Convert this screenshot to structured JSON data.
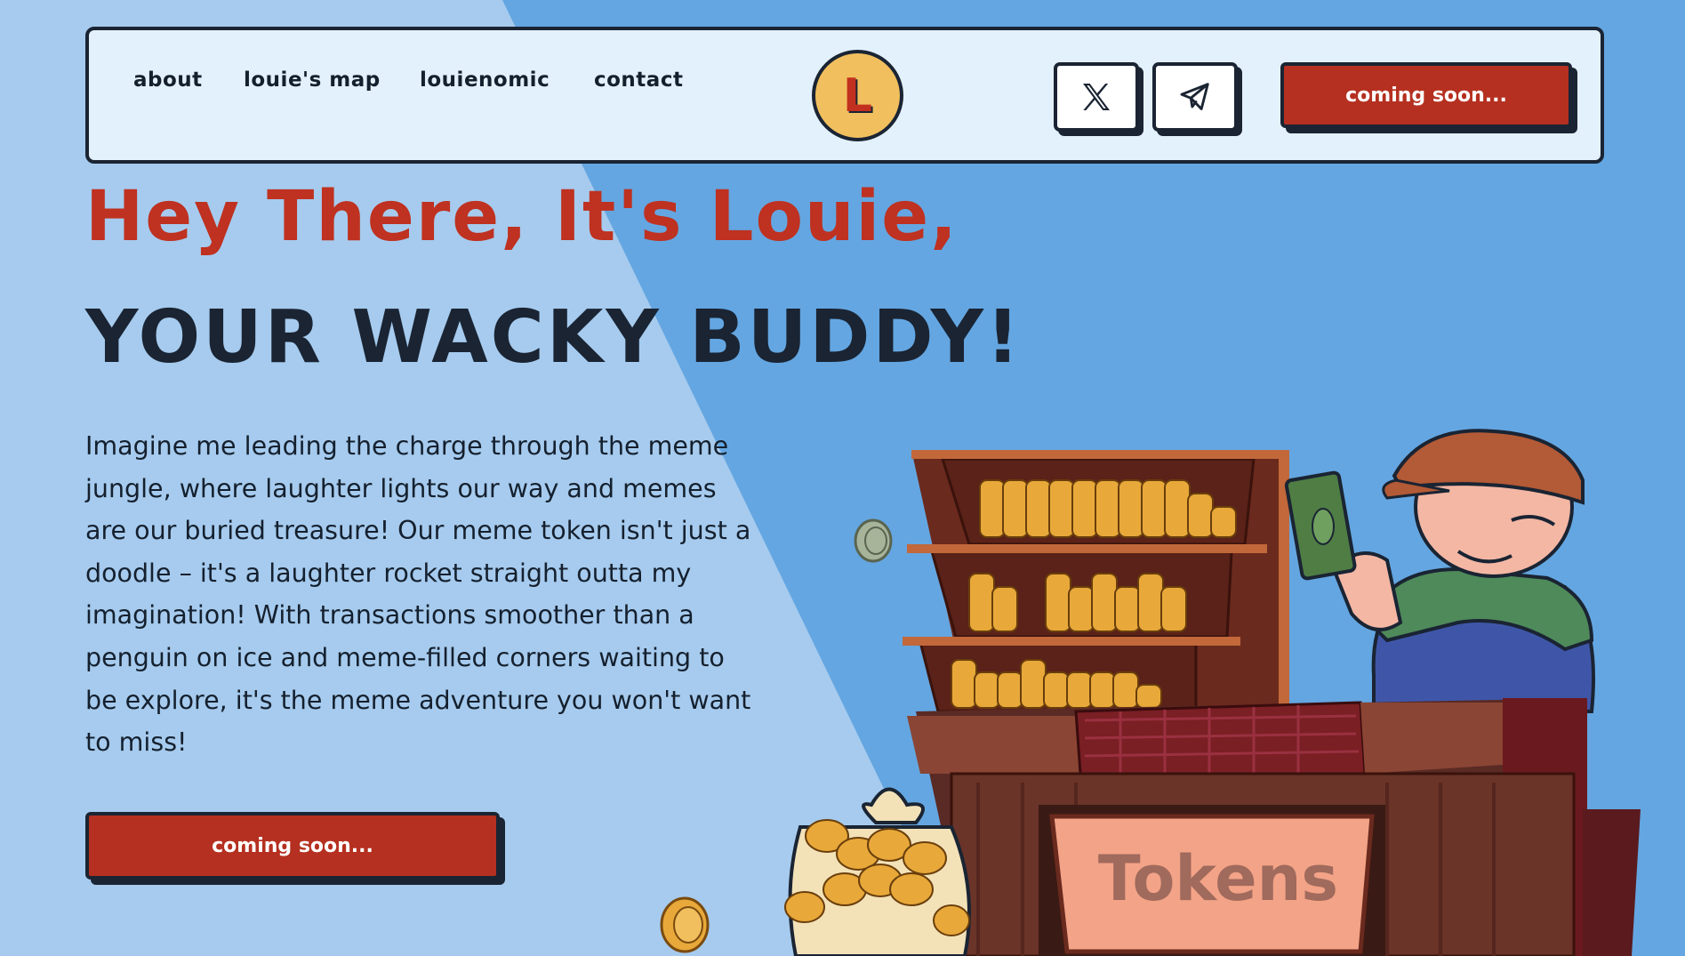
{
  "nav": {
    "links": [
      "ABOUT",
      "LOUIE'S MAP",
      "LOUIENOMIC",
      "CONTACT"
    ],
    "logo_letter": "L",
    "social": [
      {
        "name": "x",
        "icon": "x-icon"
      },
      {
        "name": "telegram",
        "icon": "telegram-icon"
      }
    ],
    "cta_label": "Coming soon..."
  },
  "hero": {
    "title_line1": "Hey There, It's Louie,",
    "title_line2": "YOUR WACKY BUDDY!",
    "description": "Imagine me leading the charge through the meme jungle, where laughter lights our way and memes are our buried treasure! Our meme token isn't just a doodle – it's a laughter rocket straight outta my imagination! With transactions smoother than a penguin on ice and meme-filled corners waiting to be explore, it's the meme adventure you won't want to miss!",
    "cta_label": "Coming soon..."
  },
  "illustration": {
    "sign_text": "Tokens",
    "coin_letter": "L"
  },
  "colors": {
    "accent_red": "#b53020",
    "title_red": "#bf3120",
    "dark": "#1a2433",
    "bg_blue": "#64a6e1",
    "bg_light_blue": "#a6cbee",
    "nav_bg": "#e3f1fc",
    "gold": "#f1bf5e"
  }
}
